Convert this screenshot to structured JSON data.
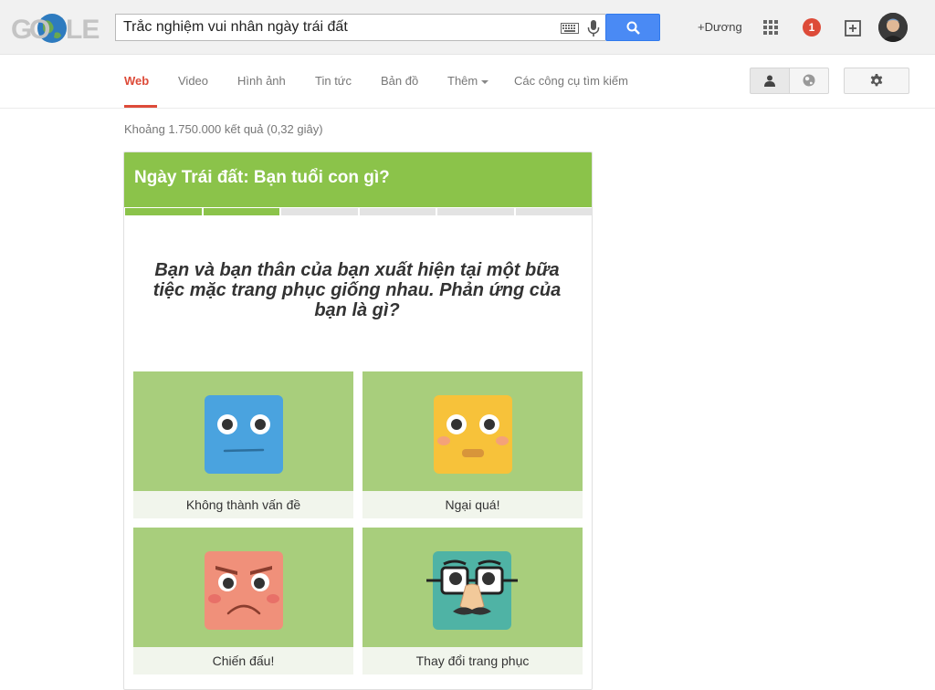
{
  "search": {
    "query": "Trắc nghiệm vui nhân ngày trái đất"
  },
  "account": {
    "plus_name": "+Dương",
    "notification_count": "1"
  },
  "nav": {
    "tabs": [
      {
        "label": "Web",
        "active": true
      },
      {
        "label": "Video"
      },
      {
        "label": "Hình ảnh"
      },
      {
        "label": "Tin tức"
      },
      {
        "label": "Bản đồ"
      },
      {
        "label": "Thêm"
      },
      {
        "label": "Các công cụ tìm kiếm"
      }
    ]
  },
  "results": {
    "stats": "Khoảng 1.750.000 kết quả (0,32 giây)"
  },
  "quiz": {
    "title": "Ngày Trái đất: Bạn tuổi con gì?",
    "progress": {
      "completed": 2,
      "total": 6
    },
    "question": "Bạn và bạn thân của bạn xuất hiện tại một bữa tiệc mặc trang phục giống nhau. Phản ứng của bạn là gì?",
    "answers": [
      {
        "label": "Không thành vấn đề",
        "icon": "blue-neutral-face-icon",
        "color": "#4aa3df"
      },
      {
        "label": "Ngại quá!",
        "icon": "yellow-shy-face-icon",
        "color": "#f7c23a"
      },
      {
        "label": "Chiến đấu!",
        "icon": "red-angry-face-icon",
        "color": "#f0907a"
      },
      {
        "label": "Thay đổi trang phục",
        "icon": "teal-disguise-face-icon",
        "color": "#4fb3a5"
      }
    ]
  },
  "colors": {
    "accent_green": "#8bc34a",
    "answer_green": "#a8ce7c",
    "active_tab": "#dd4b39",
    "search_blue": "#4a8af4"
  }
}
